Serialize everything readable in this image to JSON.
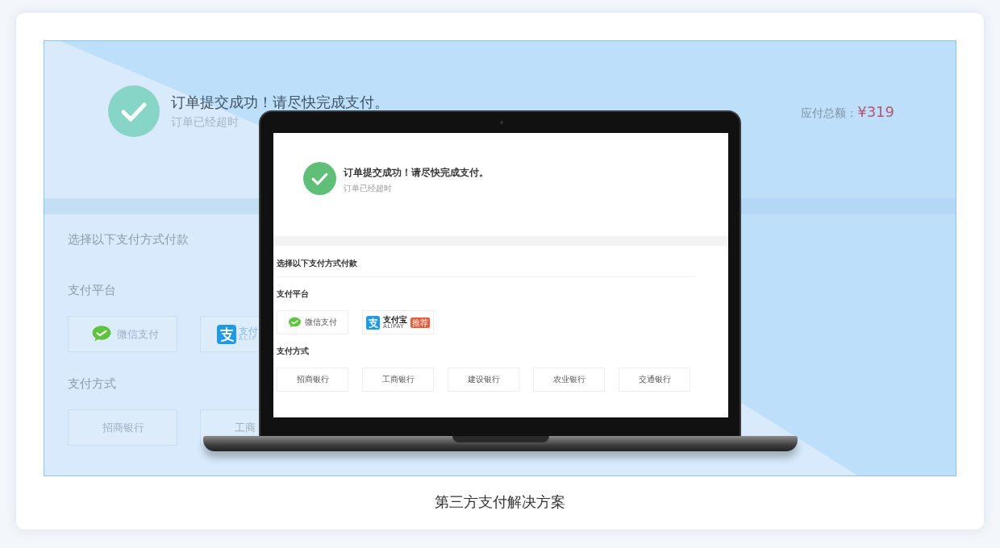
{
  "background_page": {
    "title": "订单提交成功！请尽快完成支付。",
    "subtitle": "订单已经超时",
    "total_label": "应付总额：",
    "total_amount": "¥319",
    "prompt": "选择以下支付方式付款",
    "platform_heading": "支付平台",
    "platforms": [
      {
        "kind": "wechat",
        "label": "微信支付"
      },
      {
        "kind": "alipay",
        "label": "支付",
        "sublabel": "ALIP"
      }
    ],
    "method_heading": "支付方式",
    "banks": [
      "招商银行",
      "工商"
    ]
  },
  "laptop_screen": {
    "title": "订单提交成功！请尽快完成支付。",
    "subtitle": "订单已经超时",
    "prompt": "选择以下支付方式付款",
    "platform_heading": "支付平台",
    "platforms": [
      {
        "kind": "wechat",
        "label": "微信支付"
      },
      {
        "kind": "alipay",
        "label": "支付宝",
        "sublabel": "ALIPAY",
        "badge": "推荐"
      }
    ],
    "method_heading": "支付方式",
    "banks": [
      "招商银行",
      "工商银行",
      "建设银行",
      "农业银行",
      "交通银行"
    ]
  },
  "caption": "第三方支付解决方案"
}
